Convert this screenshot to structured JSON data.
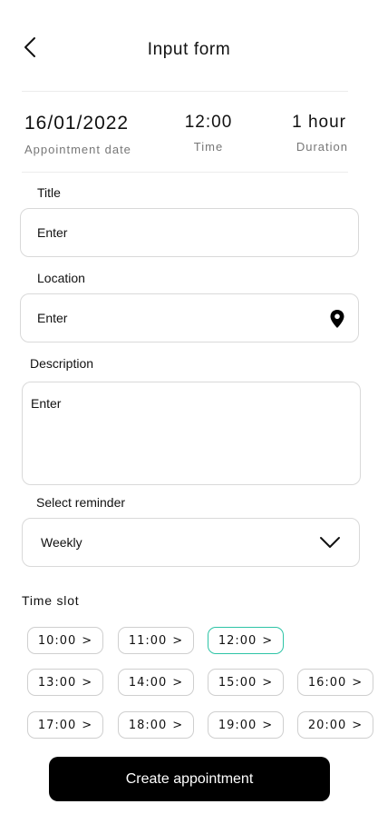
{
  "header": {
    "title": "Input form",
    "back_icon": "chevron-left-icon"
  },
  "summary": {
    "date": {
      "value": "16/01/2022",
      "label": "Appointment date"
    },
    "time": {
      "value": "12:00",
      "label": "Time"
    },
    "duration": {
      "value": "1 hour",
      "label": "Duration"
    }
  },
  "form": {
    "title": {
      "label": "Title",
      "value": "Enter"
    },
    "location": {
      "label": "Location",
      "value": "Enter",
      "icon": "map-pin-icon"
    },
    "description": {
      "label": "Description",
      "value": "Enter"
    },
    "reminder": {
      "label": "Select reminder",
      "value": "Weekly",
      "icon": "chevron-down-icon"
    }
  },
  "time_slot": {
    "label": "Time slot",
    "selected": "12:00",
    "selected_color": "#2ec4a6",
    "slots": [
      "10:00",
      "11:00",
      "12:00",
      "13:00",
      "14:00",
      "15:00",
      "16:00",
      "17:00",
      "18:00",
      "19:00",
      "20:00"
    ],
    "arrow": ">"
  },
  "cta": {
    "label": "Create appointment"
  }
}
